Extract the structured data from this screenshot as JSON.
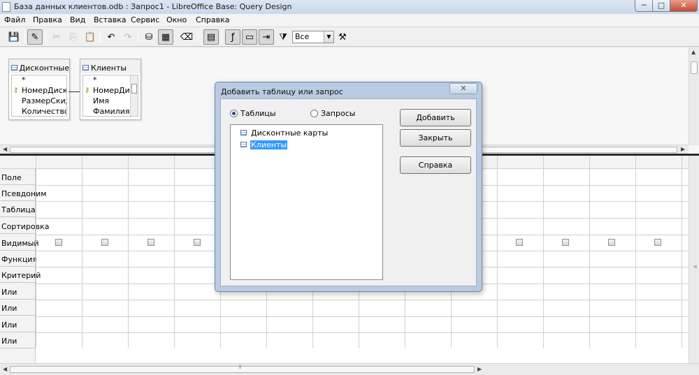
{
  "window": {
    "title": "База данных клиентов.odb : Запрос1 - LibreOffice Base: Query Design",
    "minimize": "─",
    "maximize": "□",
    "close": "✕"
  },
  "menu": [
    "Файл",
    "Правка",
    "Вид",
    "Вставка",
    "Сервис",
    "Окно",
    "Справка"
  ],
  "toolbar": {
    "limit_value": "Все"
  },
  "tables": [
    {
      "name": "Дисконтные",
      "fields": [
        "*",
        "НомерДиско",
        "РазмерСкидк",
        "КоличествоБ"
      ]
    },
    {
      "name": "Клиенты",
      "fields": [
        "*",
        "НомерДис",
        "Имя",
        "Фамилия"
      ]
    }
  ],
  "grid": {
    "row_labels": [
      "Поле",
      "Псевдоним",
      "Таблица",
      "Сортировка",
      "Видимый",
      "Функция",
      "Критерий",
      "Или",
      "Или",
      "Или",
      "Или"
    ]
  },
  "dialog": {
    "title": "Добавить таблицу или запрос",
    "close": "✕",
    "radio_tables": "Таблицы",
    "radio_queries": "Запросы",
    "items": [
      "Дисконтные карты",
      "Клиенты"
    ],
    "buttons": {
      "add": "Добавить",
      "close": "Закрыть",
      "help": "Справка"
    }
  }
}
